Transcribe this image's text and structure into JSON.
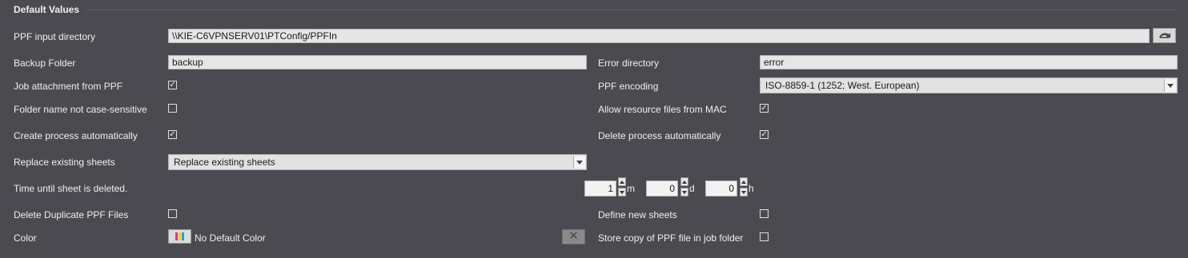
{
  "section": {
    "title": "Default Values"
  },
  "ppf_input": {
    "label": "PPF input directory",
    "value": "\\\\KIE-C6VPNSERV01\\PTConfig/PPFIn",
    "browse_icon": "folder-browse-icon"
  },
  "backup_folder": {
    "label": "Backup Folder",
    "value": "backup"
  },
  "error_directory": {
    "label": "Error directory",
    "value": "error"
  },
  "job_attachment": {
    "label": "Job attachment from PPF",
    "checked": true
  },
  "ppf_encoding": {
    "label": "PPF encoding",
    "value": "ISO-8859-1 (1252; West. European)"
  },
  "folder_case": {
    "label": "Folder name not case-sensitive",
    "checked": false
  },
  "allow_mac": {
    "label": "Allow resource files from MAC",
    "checked": true
  },
  "create_process": {
    "label": "Create process automatically",
    "checked": true
  },
  "delete_process": {
    "label": "Delete process automatically",
    "checked": true
  },
  "replace_sheets": {
    "label": "Replace existing sheets",
    "value": "Replace existing sheets"
  },
  "time_until_delete": {
    "label": "Time until sheet is deleted.",
    "months": {
      "value": "1",
      "unit": "m"
    },
    "days": {
      "value": "0",
      "unit": "d"
    },
    "hours": {
      "value": "0",
      "unit": "h"
    }
  },
  "delete_duplicate": {
    "label": "Delete Duplicate PPF Files",
    "checked": false
  },
  "define_new_sheets": {
    "label": "Define new sheets",
    "checked": false
  },
  "color": {
    "label": "Color",
    "value": "No Default Color",
    "clear_symbol": "✕"
  },
  "store_copy": {
    "label": "Store copy of PPF file in job folder",
    "checked": false
  },
  "check_mark": "✓"
}
